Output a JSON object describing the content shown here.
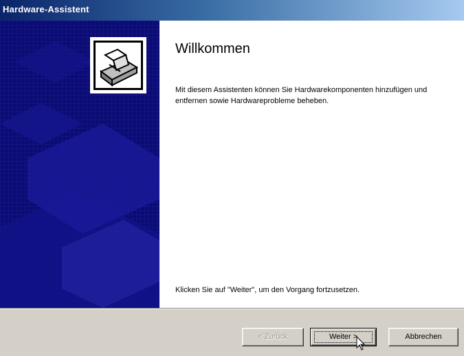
{
  "window": {
    "title": "Hardware-Assistent"
  },
  "main": {
    "heading": "Willkommen",
    "description": "Mit diesem Assistenten können Sie Hardwarekomponenten hinzufügen und entfernen sowie Hardwareprobleme beheben.",
    "hint": "Klicken Sie auf \"Weiter\", um den Vorgang fortzusetzen."
  },
  "buttons": {
    "back_label": "< Zurück",
    "next_label": "Weiter >",
    "cancel_label": "Abbrechen"
  },
  "icons": {
    "wizard": "hardware-wizard-icon",
    "cursor": "mouse-pointer-icon"
  },
  "colors": {
    "panel_background": "#0b0b74",
    "titlebar_start": "#0a246a",
    "titlebar_end": "#a6caf0"
  }
}
